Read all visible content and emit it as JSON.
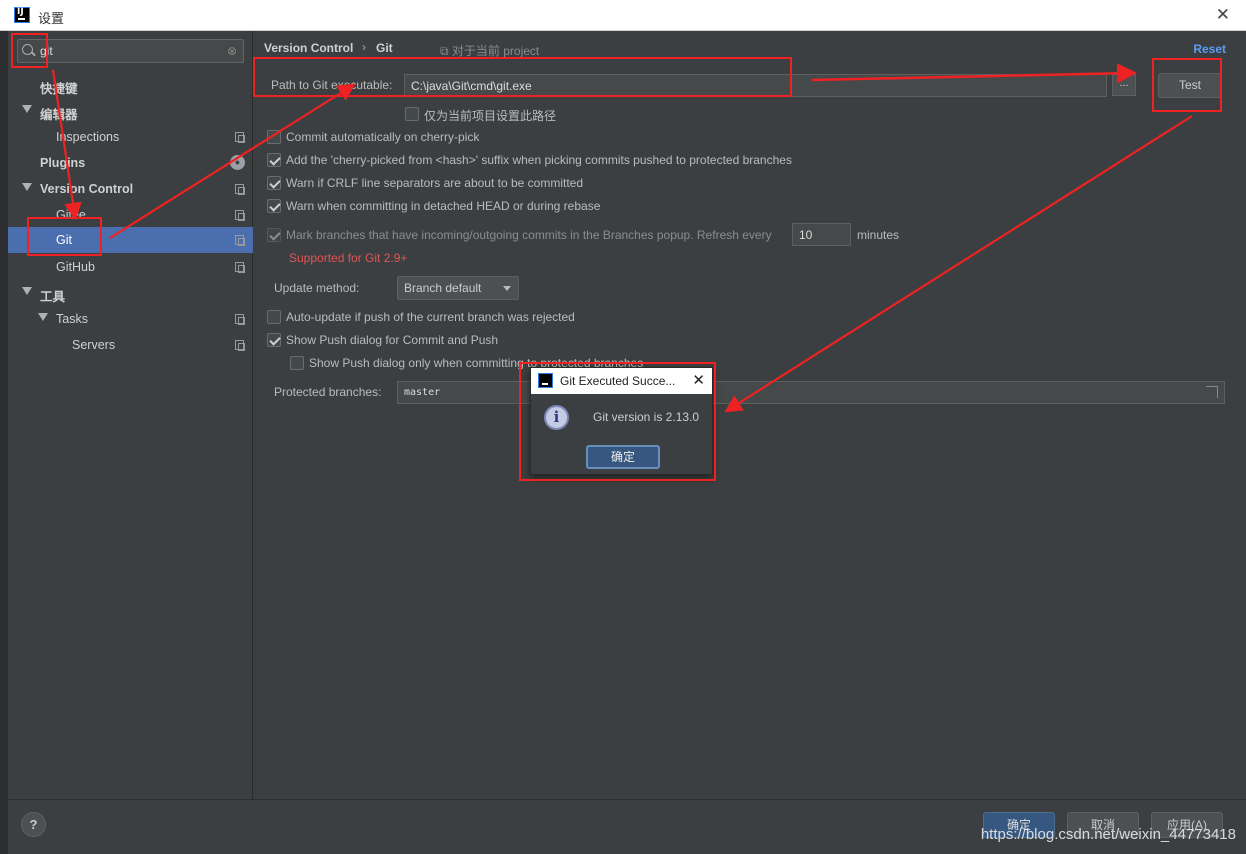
{
  "window": {
    "title": "设置"
  },
  "sidebar": {
    "search_value": "git",
    "items": [
      {
        "label": "快捷键"
      },
      {
        "label": "编辑器"
      },
      {
        "label": "Inspections"
      },
      {
        "label": "Plugins"
      },
      {
        "label": "Version Control"
      },
      {
        "label": "Gitee"
      },
      {
        "label": "Git"
      },
      {
        "label": "GitHub"
      },
      {
        "label": "工具"
      },
      {
        "label": "Tasks"
      },
      {
        "label": "Servers"
      }
    ]
  },
  "main": {
    "breadcrumb": {
      "parent": "Version Control",
      "separator": "›",
      "current": "Git"
    },
    "project_note": "⧉ 对于当前 project",
    "reset_label": "Reset",
    "path_label": "Path to Git executable:",
    "path_value": "C:\\java\\Git\\cmd\\git.exe",
    "browse_label": "...",
    "test_label": "Test",
    "project_only_label": "仅为当前项目设置此路径",
    "options": [
      {
        "label": "Commit automatically on cherry-pick",
        "checked": false
      },
      {
        "label": "Add the 'cherry-picked from <hash>' suffix when picking commits pushed to protected branches",
        "checked": true
      },
      {
        "label": "Warn if CRLF line separators are about to be committed",
        "checked": true
      },
      {
        "label": "Warn when committing in detached HEAD or during rebase",
        "checked": true
      },
      {
        "label": "Mark branches that have incoming/outgoing commits in the Branches popup.  Refresh every",
        "checked": true
      }
    ],
    "refresh_value": "10",
    "refresh_unit": "minutes",
    "support_warning": "Supported for Git 2.9+",
    "update_method_label": "Update method:",
    "update_method_value": "Branch default",
    "auto_update_label": "Auto-update if push of the current branch was rejected",
    "show_push_label": "Show Push dialog for Commit and Push",
    "show_push_protected_label": "Show Push dialog only when committing to protected branches",
    "protected_label": "Protected branches:",
    "protected_value": "master"
  },
  "dialog": {
    "title": "Git Executed Succe...",
    "close": "✕",
    "message": "Git version is 2.13.0",
    "ok_label": "确定"
  },
  "footer": {
    "help_label": "?",
    "ok_label": "确定",
    "cancel_label": "取消",
    "apply_label": "应用(A)",
    "watermark": "https://blog.csdn.net/weixin_44773418"
  },
  "colors": {
    "selection": "#4b6eaf",
    "annotation": "#ee2222",
    "link": "#589df6",
    "warning": "#e05555"
  }
}
